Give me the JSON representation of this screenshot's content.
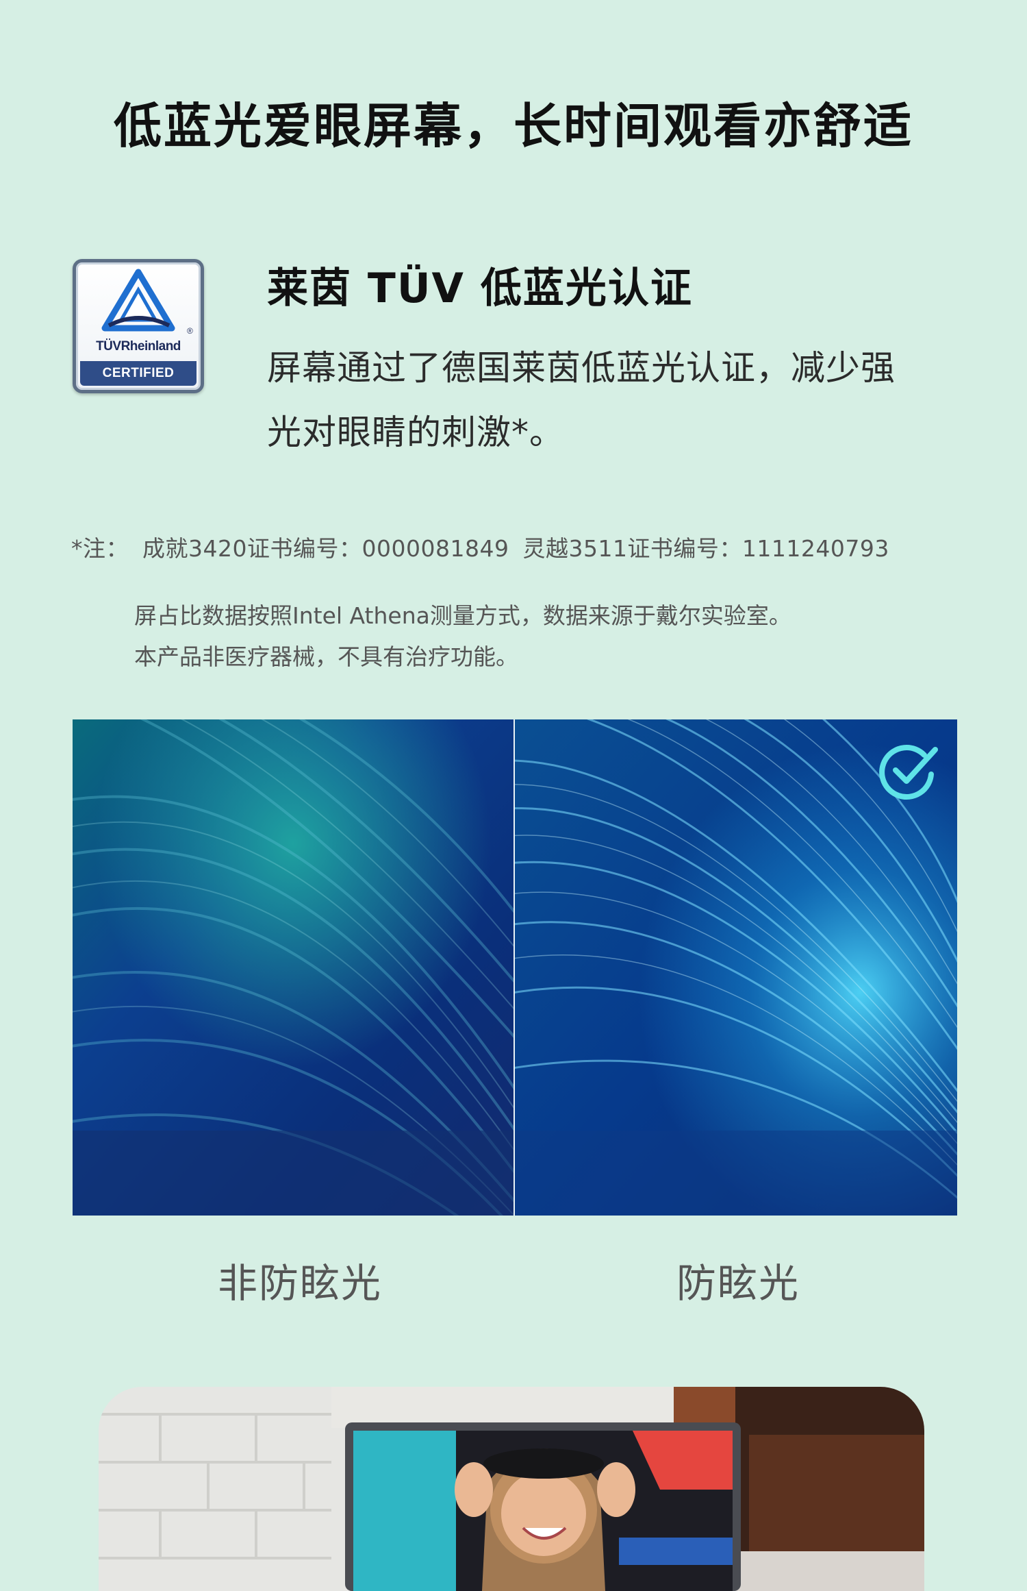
{
  "headline": "低蓝光爱眼屏幕，长时间观看亦舒适",
  "badge": {
    "brand": "TÜVRheinland",
    "certified": "CERTIFIED",
    "registered": "®"
  },
  "certification": {
    "title": "莱茵 TÜV 低蓝光认证",
    "description_line1": "屏幕通过了德国莱茵低蓝光认证，减少强",
    "description_line2": "光对眼睛的刺激*。"
  },
  "footnote": {
    "prefix": "*注：",
    "cert_a": "成就3420证书编号：0000081849",
    "cert_b": "灵越3511证书编号：1111240793",
    "line2": "屏占比数据按照Intel Athena测量方式，数据来源于戴尔实验室。",
    "line3": "本产品非医疗器械，不具有治疗功能。"
  },
  "comparison": {
    "left_label": "非防眩光",
    "right_label": "防眩光",
    "colors": {
      "left_deep": "#0b2a6b",
      "left_teal": "#1fa39a",
      "right_deep": "#07327a",
      "right_glow": "#54e0ff",
      "check": "#5fe3e8"
    }
  }
}
